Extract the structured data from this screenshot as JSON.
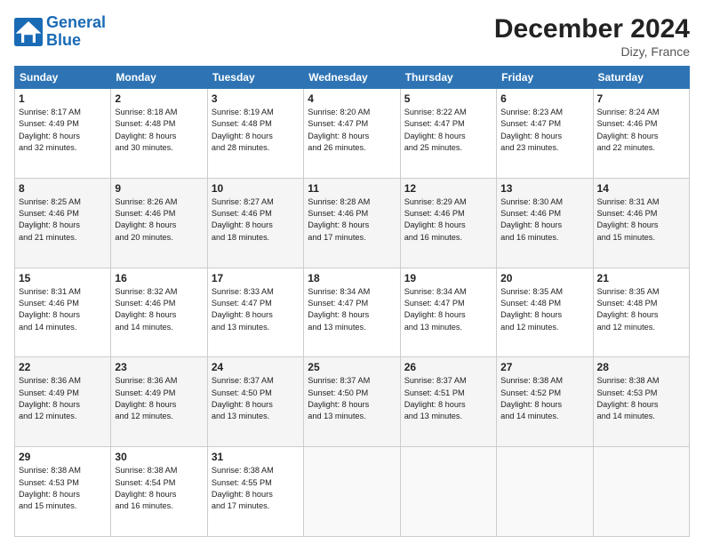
{
  "logo": {
    "line1": "General",
    "line2": "Blue"
  },
  "title": "December 2024",
  "location": "Dizy, France",
  "weekdays": [
    "Sunday",
    "Monday",
    "Tuesday",
    "Wednesday",
    "Thursday",
    "Friday",
    "Saturday"
  ],
  "weeks": [
    [
      {
        "day": "1",
        "info": "Sunrise: 8:17 AM\nSunset: 4:49 PM\nDaylight: 8 hours\nand 32 minutes."
      },
      {
        "day": "2",
        "info": "Sunrise: 8:18 AM\nSunset: 4:48 PM\nDaylight: 8 hours\nand 30 minutes."
      },
      {
        "day": "3",
        "info": "Sunrise: 8:19 AM\nSunset: 4:48 PM\nDaylight: 8 hours\nand 28 minutes."
      },
      {
        "day": "4",
        "info": "Sunrise: 8:20 AM\nSunset: 4:47 PM\nDaylight: 8 hours\nand 26 minutes."
      },
      {
        "day": "5",
        "info": "Sunrise: 8:22 AM\nSunset: 4:47 PM\nDaylight: 8 hours\nand 25 minutes."
      },
      {
        "day": "6",
        "info": "Sunrise: 8:23 AM\nSunset: 4:47 PM\nDaylight: 8 hours\nand 23 minutes."
      },
      {
        "day": "7",
        "info": "Sunrise: 8:24 AM\nSunset: 4:46 PM\nDaylight: 8 hours\nand 22 minutes."
      }
    ],
    [
      {
        "day": "8",
        "info": "Sunrise: 8:25 AM\nSunset: 4:46 PM\nDaylight: 8 hours\nand 21 minutes."
      },
      {
        "day": "9",
        "info": "Sunrise: 8:26 AM\nSunset: 4:46 PM\nDaylight: 8 hours\nand 20 minutes."
      },
      {
        "day": "10",
        "info": "Sunrise: 8:27 AM\nSunset: 4:46 PM\nDaylight: 8 hours\nand 18 minutes."
      },
      {
        "day": "11",
        "info": "Sunrise: 8:28 AM\nSunset: 4:46 PM\nDaylight: 8 hours\nand 17 minutes."
      },
      {
        "day": "12",
        "info": "Sunrise: 8:29 AM\nSunset: 4:46 PM\nDaylight: 8 hours\nand 16 minutes."
      },
      {
        "day": "13",
        "info": "Sunrise: 8:30 AM\nSunset: 4:46 PM\nDaylight: 8 hours\nand 16 minutes."
      },
      {
        "day": "14",
        "info": "Sunrise: 8:31 AM\nSunset: 4:46 PM\nDaylight: 8 hours\nand 15 minutes."
      }
    ],
    [
      {
        "day": "15",
        "info": "Sunrise: 8:31 AM\nSunset: 4:46 PM\nDaylight: 8 hours\nand 14 minutes."
      },
      {
        "day": "16",
        "info": "Sunrise: 8:32 AM\nSunset: 4:46 PM\nDaylight: 8 hours\nand 14 minutes."
      },
      {
        "day": "17",
        "info": "Sunrise: 8:33 AM\nSunset: 4:47 PM\nDaylight: 8 hours\nand 13 minutes."
      },
      {
        "day": "18",
        "info": "Sunrise: 8:34 AM\nSunset: 4:47 PM\nDaylight: 8 hours\nand 13 minutes."
      },
      {
        "day": "19",
        "info": "Sunrise: 8:34 AM\nSunset: 4:47 PM\nDaylight: 8 hours\nand 13 minutes."
      },
      {
        "day": "20",
        "info": "Sunrise: 8:35 AM\nSunset: 4:48 PM\nDaylight: 8 hours\nand 12 minutes."
      },
      {
        "day": "21",
        "info": "Sunrise: 8:35 AM\nSunset: 4:48 PM\nDaylight: 8 hours\nand 12 minutes."
      }
    ],
    [
      {
        "day": "22",
        "info": "Sunrise: 8:36 AM\nSunset: 4:49 PM\nDaylight: 8 hours\nand 12 minutes."
      },
      {
        "day": "23",
        "info": "Sunrise: 8:36 AM\nSunset: 4:49 PM\nDaylight: 8 hours\nand 12 minutes."
      },
      {
        "day": "24",
        "info": "Sunrise: 8:37 AM\nSunset: 4:50 PM\nDaylight: 8 hours\nand 13 minutes."
      },
      {
        "day": "25",
        "info": "Sunrise: 8:37 AM\nSunset: 4:50 PM\nDaylight: 8 hours\nand 13 minutes."
      },
      {
        "day": "26",
        "info": "Sunrise: 8:37 AM\nSunset: 4:51 PM\nDaylight: 8 hours\nand 13 minutes."
      },
      {
        "day": "27",
        "info": "Sunrise: 8:38 AM\nSunset: 4:52 PM\nDaylight: 8 hours\nand 14 minutes."
      },
      {
        "day": "28",
        "info": "Sunrise: 8:38 AM\nSunset: 4:53 PM\nDaylight: 8 hours\nand 14 minutes."
      }
    ],
    [
      {
        "day": "29",
        "info": "Sunrise: 8:38 AM\nSunset: 4:53 PM\nDaylight: 8 hours\nand 15 minutes."
      },
      {
        "day": "30",
        "info": "Sunrise: 8:38 AM\nSunset: 4:54 PM\nDaylight: 8 hours\nand 16 minutes."
      },
      {
        "day": "31",
        "info": "Sunrise: 8:38 AM\nSunset: 4:55 PM\nDaylight: 8 hours\nand 17 minutes."
      },
      {
        "day": "",
        "info": ""
      },
      {
        "day": "",
        "info": ""
      },
      {
        "day": "",
        "info": ""
      },
      {
        "day": "",
        "info": ""
      }
    ]
  ]
}
